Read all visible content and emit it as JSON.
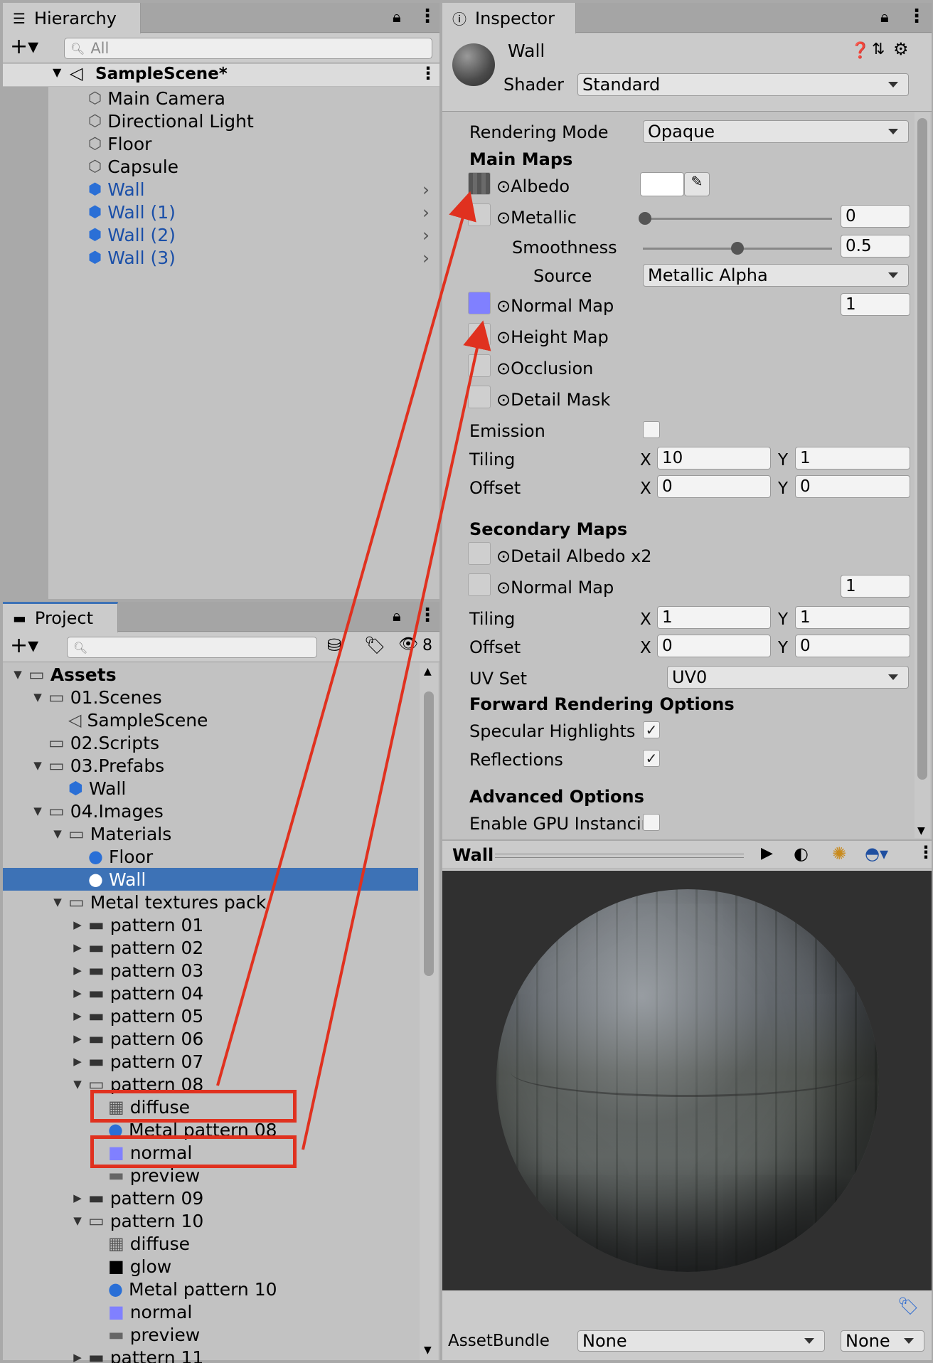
{
  "hierarchy": {
    "tab_label": "Hierarchy",
    "search_placeholder": "All",
    "scene": "SampleScene*",
    "items": [
      {
        "label": "Main Camera"
      },
      {
        "label": "Directional Light"
      },
      {
        "label": "Floor"
      },
      {
        "label": "Capsule"
      },
      {
        "label": "Wall"
      },
      {
        "label": "Wall (1)"
      },
      {
        "label": "Wall (2)"
      },
      {
        "label": "Wall (3)"
      }
    ]
  },
  "project": {
    "tab_label": "Project",
    "hidden_count": "8",
    "tree": [
      {
        "label": "Assets"
      },
      {
        "label": "01.Scenes"
      },
      {
        "label": "SampleScene"
      },
      {
        "label": "02.Scripts"
      },
      {
        "label": "03.Prefabs"
      },
      {
        "label": "Wall"
      },
      {
        "label": "04.Images"
      },
      {
        "label": "Materials"
      },
      {
        "label": "Floor"
      },
      {
        "label": "Wall"
      },
      {
        "label": "Metal textures pack"
      },
      {
        "label": "pattern 01"
      },
      {
        "label": "pattern 02"
      },
      {
        "label": "pattern 03"
      },
      {
        "label": "pattern 04"
      },
      {
        "label": "pattern 05"
      },
      {
        "label": "pattern 06"
      },
      {
        "label": "pattern 07"
      },
      {
        "label": "pattern 08"
      },
      {
        "label": "diffuse"
      },
      {
        "label": "Metal pattern 08"
      },
      {
        "label": "normal"
      },
      {
        "label": "preview"
      },
      {
        "label": "pattern 09"
      },
      {
        "label": "pattern 10"
      },
      {
        "label": "diffuse"
      },
      {
        "label": "glow"
      },
      {
        "label": "Metal pattern 10"
      },
      {
        "label": "normal"
      },
      {
        "label": "preview"
      },
      {
        "label": "pattern 11"
      }
    ]
  },
  "inspector": {
    "tab_label": "Inspector",
    "material_name": "Wall",
    "shader_label": "Shader",
    "shader_value": "Standard",
    "rendering_mode_label": "Rendering Mode",
    "rendering_mode_value": "Opaque",
    "main_maps": "Main Maps",
    "albedo": "Albedo",
    "metallic": "Metallic",
    "metallic_value": "0",
    "smoothness": "Smoothness",
    "smoothness_value": "0.5",
    "source": "Source",
    "source_value": "Metallic Alpha",
    "normal_map": "Normal Map",
    "normal_map_value": "1",
    "height_map": "Height Map",
    "occlusion": "Occlusion",
    "detail_mask": "Detail Mask",
    "emission": "Emission",
    "tiling": "Tiling",
    "offset": "Offset",
    "x": "X",
    "y": "Y",
    "tiling_x": "10",
    "tiling_y": "1",
    "offset_x": "0",
    "offset_y": "0",
    "secondary_maps": "Secondary Maps",
    "detail_albedo": "Detail Albedo x2",
    "normal_map2": "Normal Map",
    "normal_map2_value": "1",
    "tiling2_x": "1",
    "tiling2_y": "1",
    "offset2_x": "0",
    "offset2_y": "0",
    "uv_set": "UV Set",
    "uv_set_value": "UV0",
    "forward_rendering": "Forward Rendering Options",
    "specular_highlights": "Specular Highlights",
    "reflections": "Reflections",
    "advanced_options": "Advanced Options",
    "enable_gpu": "Enable GPU Instancir"
  },
  "preview": {
    "title": "Wall"
  },
  "assetbundle": {
    "label": "AssetBundle",
    "value1": "None",
    "value2": "None"
  },
  "colors": {
    "highlight": "#e0311f",
    "selection": "#3d72b6",
    "prefab_text": "#1a4fa8",
    "normal_map_swatch": "#8080ff"
  }
}
